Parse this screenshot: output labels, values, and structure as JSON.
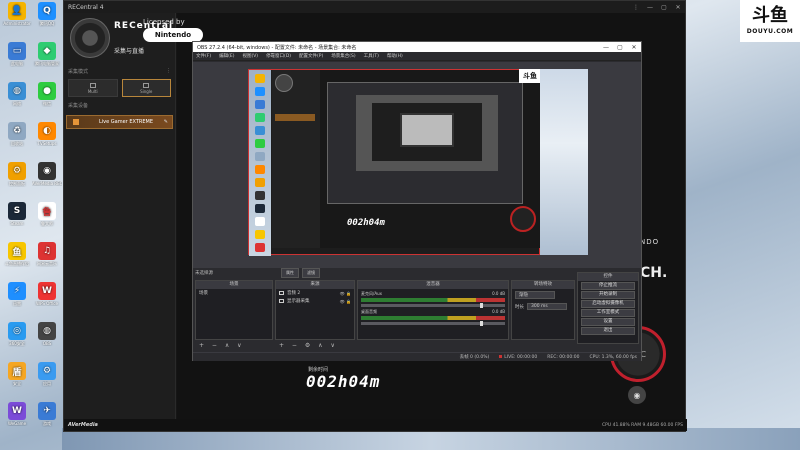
{
  "desktop": {
    "icons": [
      {
        "label": "Administrator",
        "color": "#f5b400",
        "glyph": "👤"
      },
      {
        "label": "腾讯QQ",
        "color": "#1e90ff",
        "glyph": "Q"
      },
      {
        "label": "此电脑",
        "color": "#3a7bd5",
        "glyph": "▭"
      },
      {
        "label": "腾讯电脑管家",
        "color": "#2ecc71",
        "glyph": "◆"
      },
      {
        "label": "网络",
        "color": "#3a8fd5",
        "glyph": "◍"
      },
      {
        "label": "微信",
        "color": "#2ecc40",
        "glyph": "●"
      },
      {
        "label": "回收站",
        "color": "#8fa8c2",
        "glyph": "♻"
      },
      {
        "label": "TVSetups",
        "color": "#ff8800",
        "glyph": "◐"
      },
      {
        "label": "控制面板",
        "color": "#f0a000",
        "glyph": "⚙"
      },
      {
        "label": "AVerMedia RECentral 4",
        "color": "#333333",
        "glyph": "◉"
      },
      {
        "label": "Steam",
        "color": "#1b2838",
        "glyph": "S"
      },
      {
        "label": "鲁大师",
        "color": "#ffffff",
        "glyph": "鲁"
      },
      {
        "label": "斗鱼直播伴侣",
        "color": "#f7c600",
        "glyph": "鱼"
      },
      {
        "label": "网易云音乐",
        "color": "#d33",
        "glyph": "♫"
      },
      {
        "label": "迅雷",
        "color": "#1f8fff",
        "glyph": "⚡"
      },
      {
        "label": "WPS Office",
        "color": "#e33",
        "glyph": "W"
      },
      {
        "label": "360安全",
        "color": "#2a9bf0",
        "glyph": "◎"
      },
      {
        "label": "OBS",
        "color": "#444",
        "glyph": "◍"
      },
      {
        "label": "安全",
        "color": "#f5a623",
        "glyph": "盾"
      },
      {
        "label": "应用",
        "color": "#3a9bf0",
        "glyph": "⚙"
      },
      {
        "label": "WeGame",
        "color": "#7b4bd8",
        "glyph": "W"
      },
      {
        "label": "游戏",
        "color": "#3a7bd5",
        "glyph": "✈"
      }
    ]
  },
  "douyu": {
    "brand": "斗鱼",
    "url": "DOUYU.COM"
  },
  "recentral": {
    "title": "RECentral 4",
    "brand": "RECentral",
    "subtitle": "采集与直播",
    "section_mode": "采集模式",
    "modes": [
      {
        "label": "Multi",
        "active": false
      },
      {
        "label": "Single",
        "active": true
      }
    ],
    "section_device": "采集设备",
    "device": "Live Gamer EXTREME",
    "licensed": "Licensed by",
    "nintendo": "Nintendo",
    "switch_line1": "NDO",
    "switch_line2": "CH.",
    "timer_label": "剩余时间",
    "timer": "002h04m",
    "footer_brand": "AVerMedia",
    "footer_stats": "CPU 41.88%   RAM 9.48GB   60.00 FPS",
    "rec_label": "REC"
  },
  "obs": {
    "title": "OBS 27.2.4 (64-bit, windows) - 配置文件: 未命名 - 场景集合: 未命名",
    "menu": [
      "文件(F)",
      "编辑(E)",
      "视图(V)",
      "停靠窗口(D)",
      "配置文件(P)",
      "场景集合(S)",
      "工具(T)",
      "帮助(H)"
    ],
    "scene_label": "未选择源",
    "filter_buttons": [
      "属性",
      "滤镜"
    ],
    "docks": {
      "scenes": {
        "title": "场景",
        "items": [
          "场景"
        ]
      },
      "sources": {
        "title": "来源",
        "items": [
          "音频 2",
          "显示器采集"
        ]
      },
      "mixer": {
        "title": "混音器",
        "tracks": [
          {
            "name": "麦克风/Aux",
            "db": "0.0 dB"
          },
          {
            "name": "桌面音频",
            "db": "0.0 dB"
          }
        ]
      },
      "transitions": {
        "title": "转场特效",
        "type": "渐隐",
        "duration_label": "时长",
        "duration": "300 ms"
      },
      "controls": {
        "title": "控件",
        "buttons": [
          "停止推流",
          "开始录制",
          "启动虚拟摄像机",
          "工作室模式",
          "设置",
          "退出"
        ]
      }
    },
    "status": [
      "丢帧 0 (0.0%)",
      "LIVE: 00:00:00",
      "REC: 00:00:00",
      "CPU: 1.3%, 60.00 fps"
    ],
    "mini": {
      "timer": "002h04m",
      "logo": "斗鱼"
    }
  }
}
